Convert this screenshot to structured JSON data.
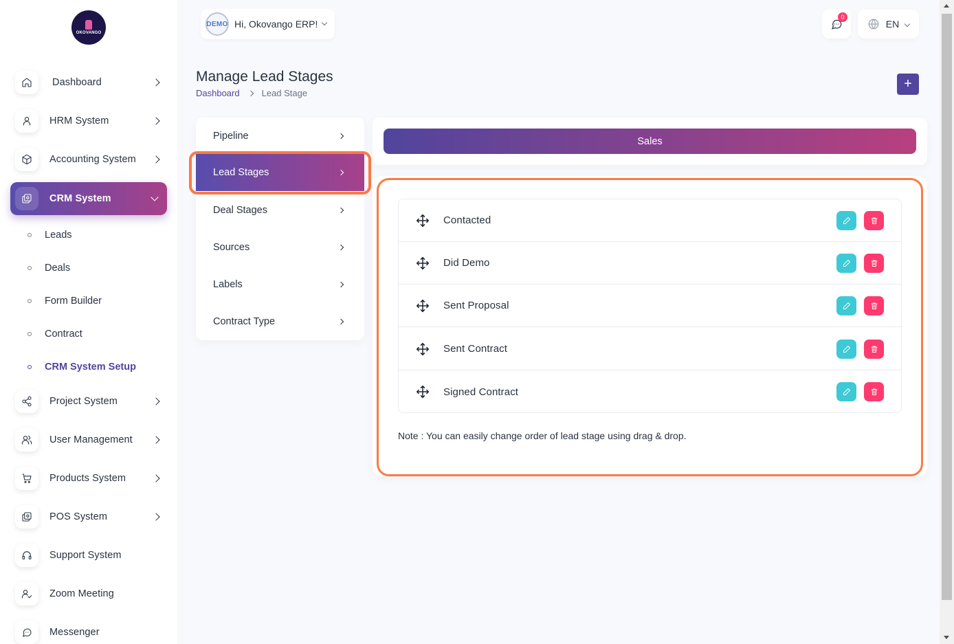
{
  "logo": {
    "text": "OKOVANGO"
  },
  "sidebar": {
    "items": [
      {
        "label": "Dashboard",
        "icon": "home-icon",
        "has_arrow": true
      },
      {
        "label": "HRM System",
        "icon": "user-icon",
        "has_arrow": true
      },
      {
        "label": "Accounting System",
        "icon": "box-icon",
        "has_arrow": true
      },
      {
        "label": "CRM System",
        "icon": "layers-icon",
        "has_arrow": true,
        "active": true
      },
      {
        "label": "Project System",
        "icon": "share-icon",
        "has_arrow": true
      },
      {
        "label": "User Management",
        "icon": "users-icon",
        "has_arrow": true
      },
      {
        "label": "Products System",
        "icon": "cart-icon",
        "has_arrow": true
      },
      {
        "label": "POS System",
        "icon": "layers-icon",
        "has_arrow": true
      },
      {
        "label": "Support System",
        "icon": "headphones-icon",
        "has_arrow": false
      },
      {
        "label": "Zoom Meeting",
        "icon": "user-check-icon",
        "has_arrow": false
      },
      {
        "label": "Messenger",
        "icon": "message-icon",
        "has_arrow": false
      }
    ],
    "crm_sub": [
      "Leads",
      "Deals",
      "Form Builder",
      "Contract",
      "CRM System Setup"
    ]
  },
  "header": {
    "avatar_text": "DEMO",
    "greeting": "Hi, Okovango ERP!",
    "notifications_count": "0",
    "language": "EN"
  },
  "page": {
    "title": "Manage Lead Stages",
    "breadcrumb": [
      "Dashboard",
      "Lead Stage"
    ],
    "add_label": "+"
  },
  "settings_menu": [
    "Pipeline",
    "Lead Stages",
    "Deal Stages",
    "Sources",
    "Labels",
    "Contract Type"
  ],
  "pipeline_tab": "Sales",
  "stages": [
    "Contacted",
    "Did Demo",
    "Sent Proposal",
    "Sent Contract",
    "Signed Contract"
  ],
  "note": "Note : You can easily change order of lead stage using drag & drop.",
  "colors": {
    "primary": "#51459d",
    "accent_gradient_end": "#a7418a",
    "edit": "#3ec9d6",
    "delete": "#ff3a6e",
    "highlight": "#fb7a45"
  }
}
